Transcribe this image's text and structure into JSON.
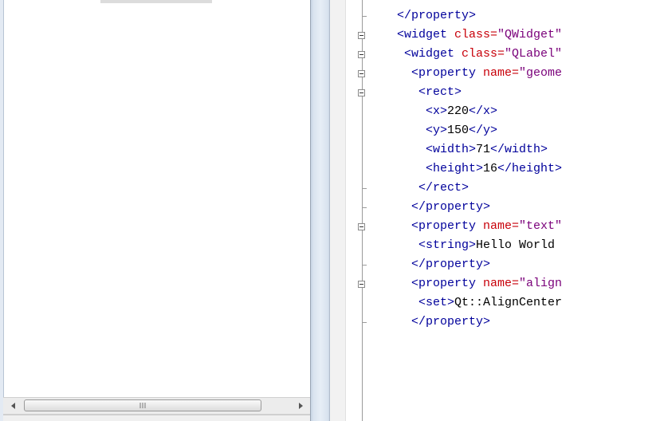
{
  "colors": {
    "tag": "#00009b",
    "attribute": "#c8000a",
    "value": "#7a007a",
    "text": "#000000",
    "splitter": "#d9e3ef",
    "gutter": "#f2f2f2"
  },
  "left_pane": {
    "scrollbar": {
      "left_arrow": "◂",
      "right_arrow": "▸",
      "grip": "III"
    }
  },
  "editor": {
    "lines": [
      {
        "indent": 0,
        "fold": "end",
        "tokens": [
          {
            "k": "tag",
            "t": "</property>"
          }
        ]
      },
      {
        "indent": 0,
        "fold": "start",
        "tokens": [
          {
            "k": "tag",
            "t": "<widget"
          },
          {
            "k": "text",
            "t": " "
          },
          {
            "k": "attr",
            "t": "class="
          },
          {
            "k": "val",
            "t": "\"QWidget\""
          }
        ]
      },
      {
        "indent": 1,
        "fold": "start",
        "tokens": [
          {
            "k": "tag",
            "t": "<widget"
          },
          {
            "k": "text",
            "t": " "
          },
          {
            "k": "attr",
            "t": "class="
          },
          {
            "k": "val",
            "t": "\"QLabel\""
          }
        ]
      },
      {
        "indent": 2,
        "fold": "start",
        "tokens": [
          {
            "k": "tag",
            "t": "<property"
          },
          {
            "k": "text",
            "t": " "
          },
          {
            "k": "attr",
            "t": "name="
          },
          {
            "k": "val",
            "t": "\"geome"
          }
        ]
      },
      {
        "indent": 3,
        "fold": "start",
        "tokens": [
          {
            "k": "tag",
            "t": "<rect>"
          }
        ]
      },
      {
        "indent": 4,
        "fold": "none",
        "tokens": [
          {
            "k": "tag",
            "t": "<x>"
          },
          {
            "k": "text",
            "t": "220"
          },
          {
            "k": "tag",
            "t": "</x>"
          }
        ]
      },
      {
        "indent": 4,
        "fold": "none",
        "tokens": [
          {
            "k": "tag",
            "t": "<y>"
          },
          {
            "k": "text",
            "t": "150"
          },
          {
            "k": "tag",
            "t": "</y>"
          }
        ]
      },
      {
        "indent": 4,
        "fold": "none",
        "tokens": [
          {
            "k": "tag",
            "t": "<width>"
          },
          {
            "k": "text",
            "t": "71"
          },
          {
            "k": "tag",
            "t": "</width>"
          }
        ]
      },
      {
        "indent": 4,
        "fold": "none",
        "tokens": [
          {
            "k": "tag",
            "t": "<height>"
          },
          {
            "k": "text",
            "t": "16"
          },
          {
            "k": "tag",
            "t": "</height>"
          }
        ]
      },
      {
        "indent": 3,
        "fold": "end",
        "tokens": [
          {
            "k": "tag",
            "t": "</rect>"
          }
        ]
      },
      {
        "indent": 2,
        "fold": "end",
        "tokens": [
          {
            "k": "tag",
            "t": "</property>"
          }
        ]
      },
      {
        "indent": 2,
        "fold": "start",
        "tokens": [
          {
            "k": "tag",
            "t": "<property"
          },
          {
            "k": "text",
            "t": " "
          },
          {
            "k": "attr",
            "t": "name="
          },
          {
            "k": "val",
            "t": "\"text\""
          }
        ]
      },
      {
        "indent": 3,
        "fold": "none",
        "tokens": [
          {
            "k": "tag",
            "t": "<string>"
          },
          {
            "k": "text",
            "t": "Hello World"
          }
        ]
      },
      {
        "indent": 2,
        "fold": "end",
        "tokens": [
          {
            "k": "tag",
            "t": "</property>"
          }
        ]
      },
      {
        "indent": 2,
        "fold": "start",
        "tokens": [
          {
            "k": "tag",
            "t": "<property"
          },
          {
            "k": "text",
            "t": " "
          },
          {
            "k": "attr",
            "t": "name="
          },
          {
            "k": "val",
            "t": "\"align"
          }
        ]
      },
      {
        "indent": 3,
        "fold": "none",
        "tokens": [
          {
            "k": "tag",
            "t": "<set>"
          },
          {
            "k": "text",
            "t": "Qt::AlignCenter"
          }
        ]
      },
      {
        "indent": 2,
        "fold": "end",
        "tokens": [
          {
            "k": "tag",
            "t": "</property>"
          }
        ]
      }
    ]
  }
}
